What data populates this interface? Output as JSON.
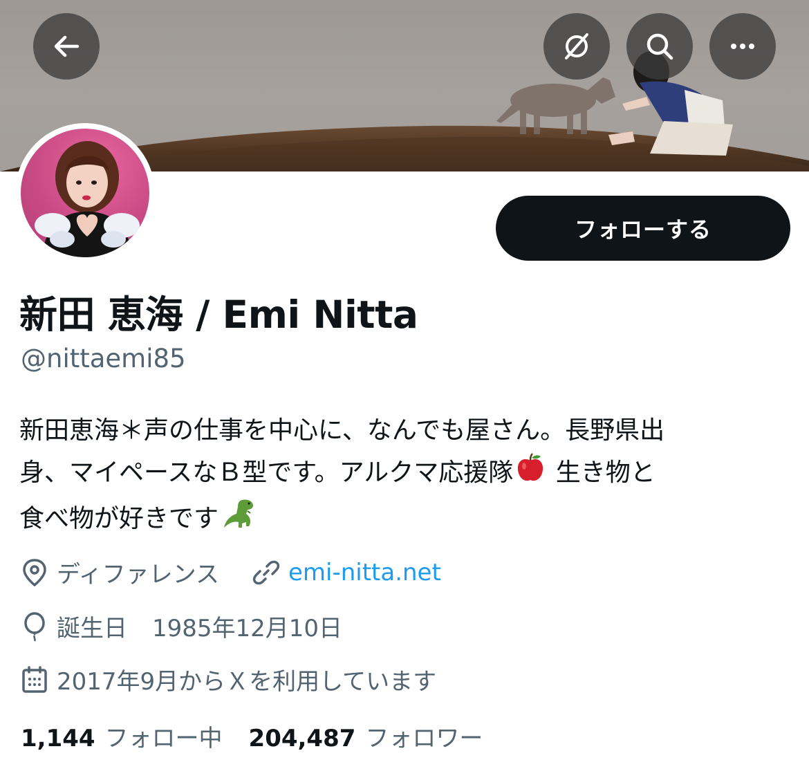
{
  "header": {
    "back_icon": "arrow-left-icon",
    "translate_icon": "translate-off-icon",
    "search_icon": "search-icon",
    "more_icon": "more-dots-icon"
  },
  "profile": {
    "display_name": "新田 恵海 / Emi Nitta",
    "handle": "@nittaemi85",
    "follow_label": "フォローする",
    "bio_lines": [
      "新田恵海＊声の仕事を中心に、なんでも屋さん。長野県出",
      "身、マイペースなＢ型です。アルクマ応援隊",
      "生き物と",
      "食べ物が好きです"
    ],
    "location": "ディファレンス",
    "website": "emi-nitta.net",
    "birthday_label": "誕生日",
    "birthday": "1985年12月10日",
    "joined": "2017年9月からＸを利用しています"
  },
  "stats": {
    "following_count": "1,144",
    "following_label": "フォロー中",
    "followers_count": "204,487",
    "followers_label": "フォロワー"
  },
  "colors": {
    "primary_text": "#0f1419",
    "secondary_text": "#536471",
    "link": "#1d9bf0",
    "follow_button": "#0f1419"
  }
}
